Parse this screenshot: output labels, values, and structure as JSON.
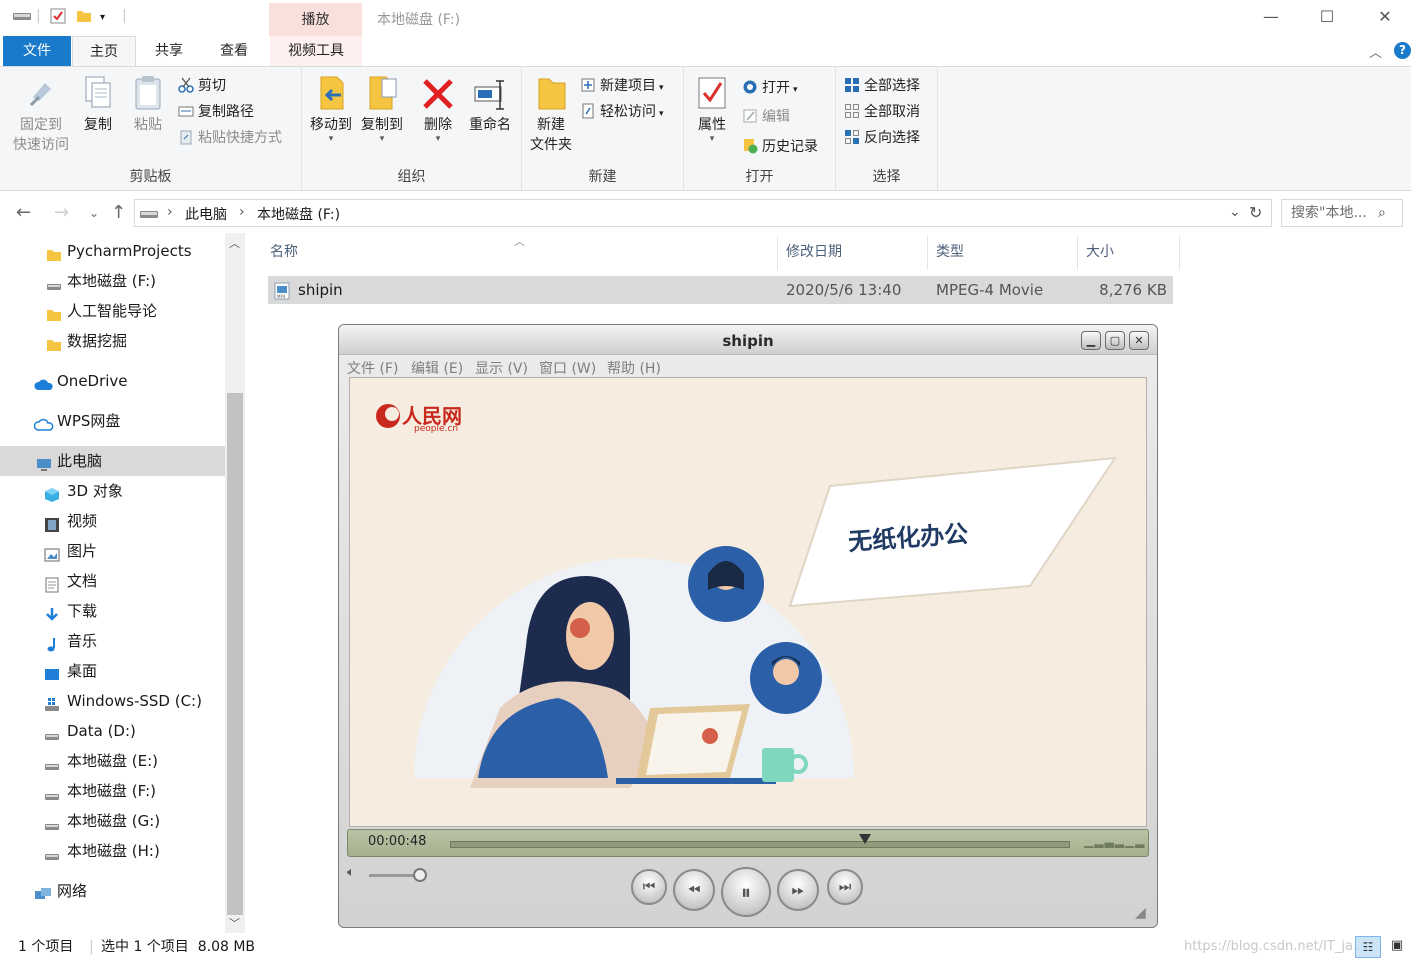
{
  "window": {
    "title": "本地磁盘 (F:)",
    "context_tab": "播放",
    "minimize": "—",
    "maximize": "☐",
    "close": "✕"
  },
  "ribbon_tabs": [
    {
      "label": "文件"
    },
    {
      "label": "主页"
    },
    {
      "label": "共享"
    },
    {
      "label": "查看"
    },
    {
      "label": "视频工具"
    }
  ],
  "ribbon": {
    "clipboard": {
      "label": "剪贴板",
      "pin": "固定到\n快速访问",
      "copy": "复制",
      "paste": "粘贴",
      "cut": "剪切",
      "copy_path": "复制路径",
      "paste_shortcut": "粘贴快捷方式"
    },
    "organize": {
      "label": "组织",
      "move_to": "移动到",
      "copy_to": "复制到",
      "delete": "删除",
      "rename": "重命名"
    },
    "new": {
      "label": "新建",
      "new_folder": "新建\n文件夹",
      "new_item": "新建项目",
      "easy_access": "轻松访问"
    },
    "open": {
      "label": "打开",
      "properties": "属性",
      "open": "打开",
      "edit": "编辑",
      "history": "历史记录"
    },
    "select": {
      "label": "选择",
      "select_all": "全部选择",
      "select_none": "全部取消",
      "invert": "反向选择"
    }
  },
  "address": {
    "crumbs": [
      "此电脑",
      "本地磁盘 (F:)"
    ],
    "search_placeholder": "搜索\"本地..."
  },
  "nav": [
    {
      "label": "PycharmProjects",
      "icon": "folder-icon"
    },
    {
      "label": "本地磁盘 (F:)",
      "icon": "drive-icon"
    },
    {
      "label": "人工智能导论",
      "icon": "folder-icon"
    },
    {
      "label": "数据挖掘",
      "icon": "folder-icon"
    },
    {
      "label": "OneDrive",
      "icon": "cloud-icon"
    },
    {
      "label": "WPS网盘",
      "icon": "cloud-outline-icon"
    },
    {
      "label": "此电脑",
      "icon": "computer-icon"
    },
    {
      "label": "3D 对象",
      "icon": "cube-icon"
    },
    {
      "label": "视频",
      "icon": "film-icon"
    },
    {
      "label": "图片",
      "icon": "picture-icon"
    },
    {
      "label": "文档",
      "icon": "document-icon"
    },
    {
      "label": "下载",
      "icon": "download-icon"
    },
    {
      "label": "音乐",
      "icon": "music-icon"
    },
    {
      "label": "桌面",
      "icon": "desktop-icon"
    },
    {
      "label": "Windows-SSD (C:)",
      "icon": "windows-drive-icon"
    },
    {
      "label": "Data (D:)",
      "icon": "drive-icon"
    },
    {
      "label": "本地磁盘 (E:)",
      "icon": "drive-icon"
    },
    {
      "label": "本地磁盘 (F:)",
      "icon": "drive-icon"
    },
    {
      "label": "本地磁盘 (G:)",
      "icon": "drive-icon"
    },
    {
      "label": "本地磁盘 (H:)",
      "icon": "drive-icon"
    },
    {
      "label": "网络",
      "icon": "network-icon"
    }
  ],
  "columns": [
    "名称",
    "修改日期",
    "类型",
    "大小"
  ],
  "files": [
    {
      "name": "shipin",
      "modified": "2020/5/6 13:40",
      "type": "MPEG-4 Movie",
      "size": "8,276 KB"
    }
  ],
  "status": {
    "count": "1 个项目",
    "selected": "选中 1 个项目  8.08 MB",
    "watermark": "https://blog.csdn.net/IT_ja..."
  },
  "player": {
    "title": "shipin",
    "menu": [
      "文件 (F)",
      "编辑 (E)",
      "显示 (V)",
      "窗口 (W)",
      "帮助 (H)"
    ],
    "time": "00:00:48",
    "progress": 0.67,
    "video": {
      "logo_text": "人民网",
      "logo_sub": "people.cn",
      "banner": "无纸化办公"
    }
  },
  "colors": {
    "accent": "#1979ca",
    "ribbon_bg": "#f5f6f7",
    "selection": "#d9d9d9",
    "video_bg": "#f6ede0",
    "banner_text": "#1f3a63"
  }
}
